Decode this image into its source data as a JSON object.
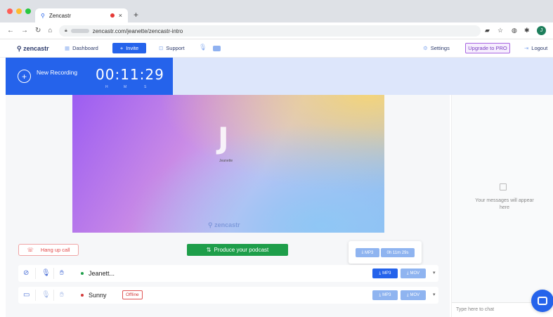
{
  "browser": {
    "tab_title": "Zencastr",
    "new_tab_icon": "+",
    "close_icon": "×",
    "url": "zencastr.com/jeanette/zencastr-intro",
    "profile_initial": "J"
  },
  "nav": {
    "logo": "zencastr",
    "dashboard": "Dashboard",
    "invite": "Invite",
    "support": "Support",
    "settings": "Settings",
    "upgrade": "Upgrade to PRO",
    "logout": "Logout"
  },
  "recording": {
    "label": "New Recording",
    "hours": "00",
    "minutes": "11",
    "seconds": "29",
    "unit_h": "H",
    "unit_m": "M",
    "unit_s": "S"
  },
  "video": {
    "initial": "J",
    "name": "Jeanette",
    "watermark": "zencastr"
  },
  "controls": {
    "hangup": "Hang up call",
    "produce": "Produce your podcast"
  },
  "tooltip": {
    "mp3": "MP3",
    "duration": "0h 11m 29s"
  },
  "participants": [
    {
      "name": "Jeanett...",
      "status_color": "#1e9e4a",
      "mp3": "MP3",
      "mov": "MOV",
      "offline": ""
    },
    {
      "name": "Sunny",
      "status_color": "#d23a3a",
      "mp3": "MP3",
      "mov": "MOV",
      "offline": "Offline"
    }
  ],
  "chat": {
    "empty_message": "Your messages will appear here",
    "input_placeholder": "Type here to chat"
  },
  "colors": {
    "brand_blue": "#2563eb",
    "produce_green": "#1e9e4a",
    "hangup_red": "#e24a4a",
    "upgrade_purple": "#7a3fc0"
  }
}
